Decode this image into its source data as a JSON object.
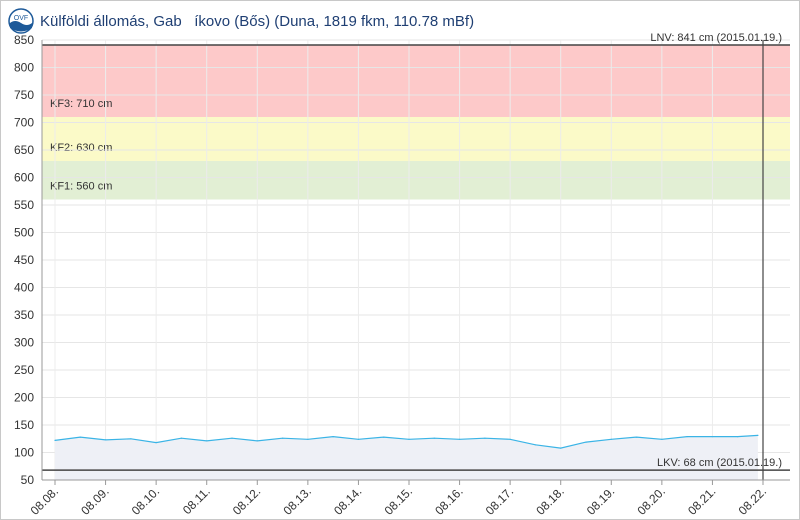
{
  "header": {
    "title": "Külföldi állomás, Gab   íkovo (Bős) (Duna, 1819 fkm, 110.78 mBf)",
    "logo_text": "OVF"
  },
  "chart_data": {
    "type": "area",
    "title": "Külföldi állomás, Gab   íkovo (Bős) (Duna, 1819 fkm, 110.78 mBf)",
    "ylim": [
      50,
      850
    ],
    "y_ticks": [
      50,
      100,
      150,
      200,
      250,
      300,
      350,
      400,
      450,
      500,
      550,
      600,
      650,
      700,
      750,
      800,
      850
    ],
    "x_tick_labels": [
      "08.08.",
      "08.09.",
      "08.10.",
      "08.11.",
      "08.12.",
      "08.13.",
      "08.14.",
      "08.15.",
      "08.16.",
      "08.17.",
      "08.18.",
      "08.19.",
      "08.20.",
      "08.21.",
      "08.22."
    ],
    "x_range": [
      8.0,
      22.0
    ],
    "series": [
      {
        "x": [
          8.0,
          8.5,
          9.0,
          9.5,
          10.0,
          10.5,
          11.0,
          11.5,
          12.0,
          12.5,
          13.0,
          13.5,
          14.0,
          14.5,
          15.0,
          15.5,
          16.0,
          16.5,
          17.0,
          17.5,
          18.0,
          18.5,
          19.0,
          19.5,
          20.0,
          20.5,
          21.0,
          21.5,
          21.9
        ],
        "values": [
          122,
          128,
          123,
          125,
          118,
          126,
          121,
          126,
          121,
          126,
          124,
          129,
          124,
          128,
          124,
          126,
          124,
          126,
          124,
          114,
          108,
          119,
          124,
          128,
          124,
          129,
          129,
          129,
          131
        ]
      }
    ],
    "bands": [
      {
        "label": "KF1: 560 cm",
        "from": 560,
        "to": 630,
        "color": "#e2efd4"
      },
      {
        "label": "KF2: 630 cm",
        "from": 630,
        "to": 710,
        "color": "#fbfac8"
      },
      {
        "label": "KF3: 710 cm",
        "from": 710,
        "to": 841,
        "color": "#fdc9c9"
      }
    ],
    "reference_lines": [
      {
        "label": "LNV: 841 cm (2015.01.19.)",
        "value": 841
      },
      {
        "label": "LKV: 68 cm (2015.01.19.)",
        "value": 68
      }
    ],
    "vertical_marker_x": 22.0,
    "line_color": "#3ab4e6",
    "fill_color": "#eef0f6",
    "grid": true
  }
}
